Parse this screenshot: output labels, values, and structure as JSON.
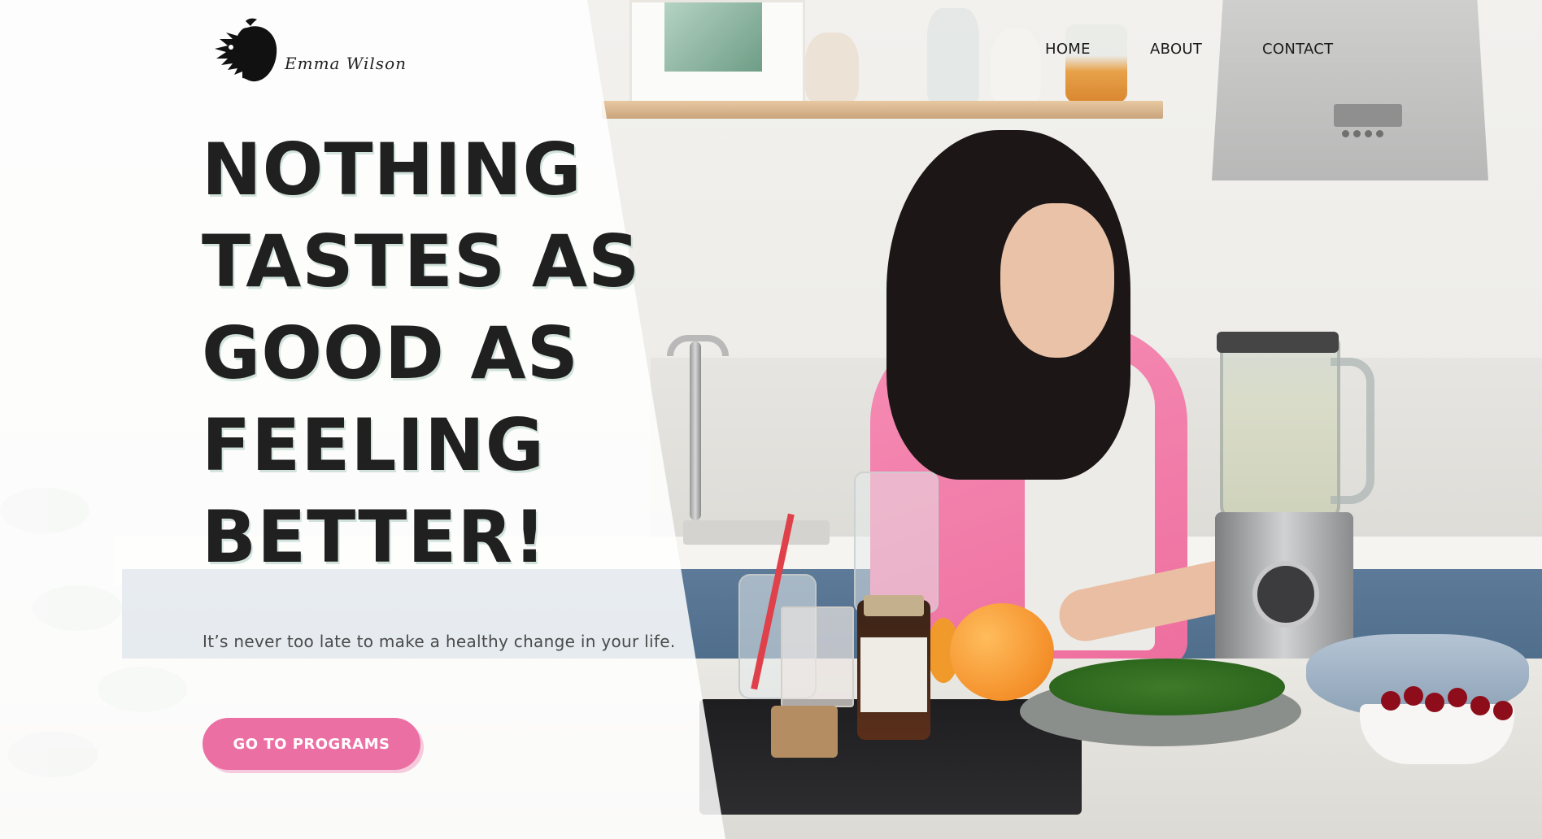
{
  "brand": {
    "name": "Emma Wilson",
    "logo_icon": "apple-crocodile-logo-icon"
  },
  "nav": {
    "items": [
      {
        "label": "HOME"
      },
      {
        "label": "ABOUT"
      },
      {
        "label": "CONTACT"
      }
    ]
  },
  "hero": {
    "headline_lines": [
      "NOTHING",
      "TASTES AS",
      "GOOD AS",
      "FEELING",
      "BETTER!"
    ],
    "tagline": "It’s never too late to make a healthy change in your life.",
    "cta_label": "GO TO PROGRAMS"
  },
  "colors": {
    "accent": "#ec6fa4",
    "headline": "#202020",
    "text": "#4a4a4a"
  }
}
